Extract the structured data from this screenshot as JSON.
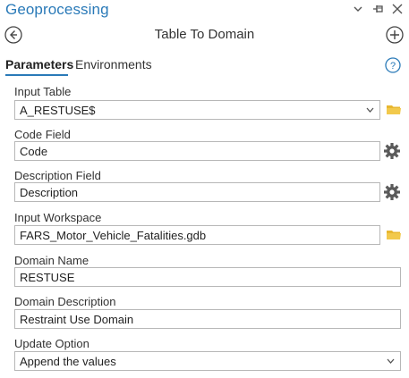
{
  "pane": {
    "title": "Geoprocessing"
  },
  "tool": {
    "title": "Table To Domain"
  },
  "tabs": {
    "parameters": "Parameters",
    "environments": "Environments"
  },
  "params": {
    "input_table": {
      "label": "Input Table",
      "value": "A_RESTUSE$"
    },
    "code_field": {
      "label": "Code Field",
      "value": "Code"
    },
    "description_field": {
      "label": "Description Field",
      "value": "Description"
    },
    "input_workspace": {
      "label": "Input Workspace",
      "value": "FARS_Motor_Vehicle_Fatalities.gdb"
    },
    "domain_name": {
      "label": "Domain Name",
      "value": "RESTUSE"
    },
    "domain_description": {
      "label": "Domain Description",
      "value": "Restraint Use Domain"
    },
    "update_option": {
      "label": "Update Option",
      "value": "Append the values"
    }
  },
  "colors": {
    "accent": "#2a7ab8",
    "folder": "#e8b730",
    "gear": "#5a5a5a"
  },
  "icons": [
    "chevron-down-icon",
    "pin-icon",
    "close-icon",
    "back-icon",
    "add-icon",
    "help-icon",
    "folder-icon",
    "gear-icon"
  ]
}
